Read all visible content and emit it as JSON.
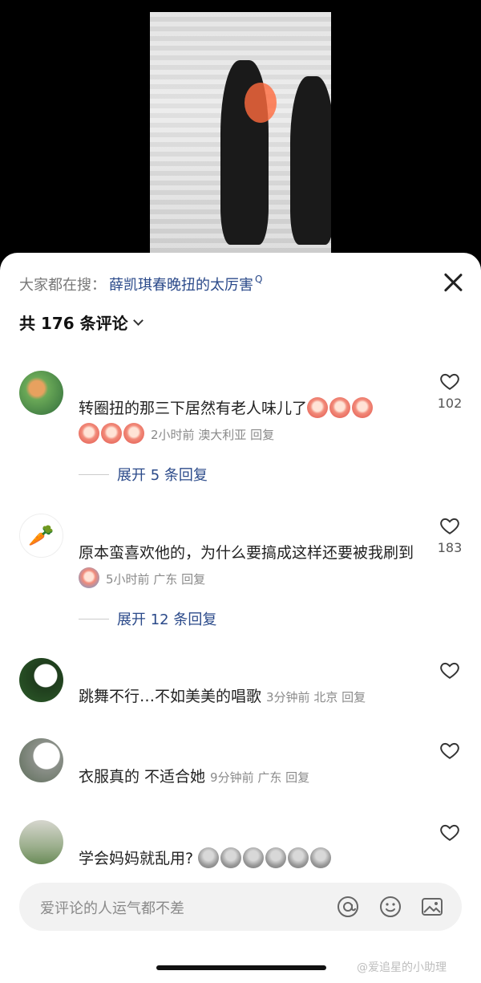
{
  "search": {
    "prefix": "大家都在搜：",
    "term": "薛凯琪春晚扭的太厉害",
    "term_mark": "Q"
  },
  "comment_count": "共 176 条评论",
  "comments": [
    {
      "username": "",
      "text": "转圈扭的那三下居然有老人味儿了",
      "meta": "2小时前  澳大利亚  回复",
      "likes": "102",
      "expand": "展开 5 条回复",
      "avatar_icon": "avatar-icon"
    },
    {
      "username": "",
      "text": "原本蛮喜欢他的，为什么要搞成这样还要被我刷到",
      "meta": "5小时前  广东  回复",
      "likes": "183",
      "expand": "展开 12 条回复",
      "avatar_icon": "carrot-icon"
    },
    {
      "username": "",
      "text": "跳舞不行…不如美美的唱歌",
      "meta": "3分钟前  北京  回复",
      "likes": ""
    },
    {
      "username": "",
      "text": "衣服真的 不适合她",
      "meta": "9分钟前  广东  回复",
      "likes": ""
    },
    {
      "username": "",
      "text": "学会妈妈就乱用?",
      "meta": "",
      "likes": ""
    }
  ],
  "input": {
    "placeholder": "爱评论的人运气都不差"
  },
  "watermark": "@爱追星的小助理",
  "colors": {
    "accent": "#2b4a8a",
    "sheet_bg": "#ffffff",
    "input_bg": "#f2f2f2"
  }
}
